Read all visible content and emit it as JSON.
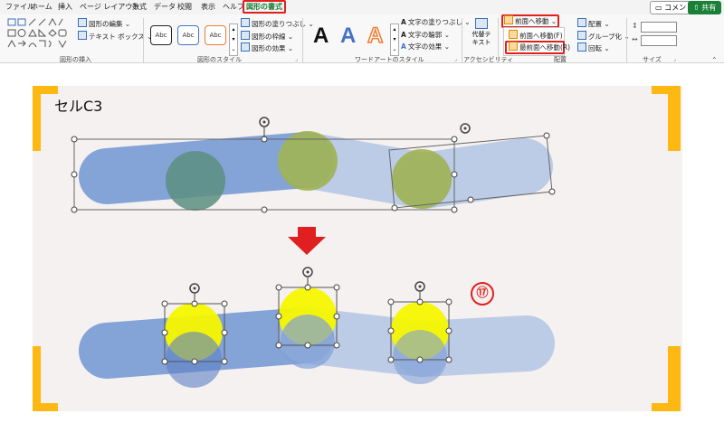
{
  "menu": {
    "items": [
      "ファイル",
      "ホーム",
      "挿入",
      "ページ レイアウト",
      "数式",
      "データ",
      "校閲",
      "表示",
      "ヘルプ"
    ],
    "active_tab": "図形の書式",
    "comment_button": "コメント",
    "share_button": "共有"
  },
  "ribbon": {
    "insert_shapes": {
      "edit_shape": "図形の編集",
      "text_box": "テキスト ボックス",
      "label": "図形の挿入"
    },
    "shape_styles": {
      "sample_text": "Abc",
      "fill": "図形の塗りつぶし",
      "outline": "図形の枠線",
      "effects": "図形の効果",
      "label": "図形のスタイル"
    },
    "wordart": {
      "letter": "A",
      "text_fill": "文字の塗りつぶし",
      "text_outline": "文字の輪郭",
      "text_effects": "文字の効果",
      "label": "ワードアートのスタイル"
    },
    "accessibility": {
      "alt_text_line1": "代替テ",
      "alt_text_line2": "キスト",
      "label": "アクセシビリティ"
    },
    "arrange": {
      "bring_forward": "前面へ移動",
      "bring_forward_item": "前面へ移動(F)",
      "bring_to_front_item": "最前面へ移動(R)",
      "align": "配置",
      "group": "グループ化",
      "rotate": "回転",
      "label": "配置"
    },
    "size": {
      "label": "サイズ"
    }
  },
  "sheet": {
    "cell_label": "セルC3",
    "step_number": "⑰"
  },
  "colors": {
    "accent_green": "#1a7f37",
    "highlight_red": "#e02020",
    "frame_orange": "#fdb912",
    "band_blue": "#7f9fd6",
    "circle_olive": "#9eb24a",
    "circle_yellow": "#f7f700"
  },
  "icons": [
    "rotate-handle-icon",
    "down-arrow-icon",
    "bring-forward-icon",
    "bring-to-front-icon",
    "alt-text-icon"
  ]
}
